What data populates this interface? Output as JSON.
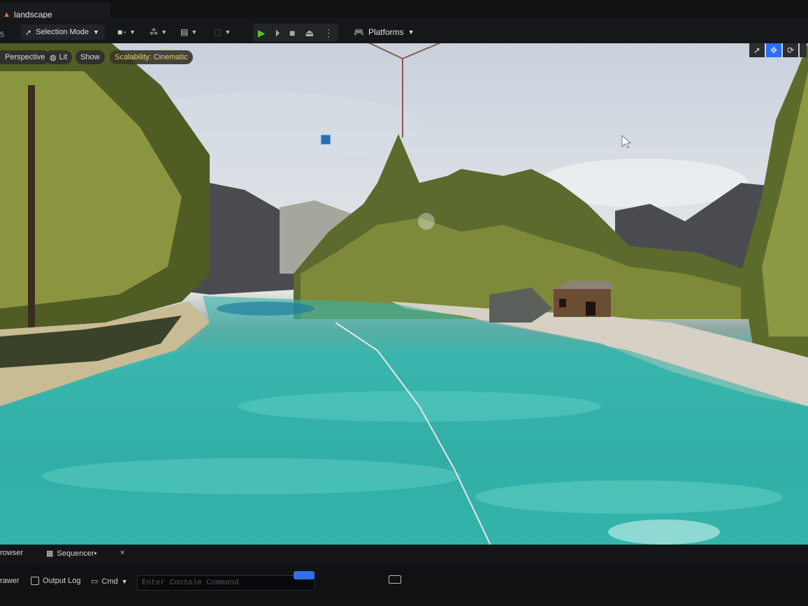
{
  "window": {
    "tab_title": "landscape",
    "left_index": "5"
  },
  "toolbar": {
    "selection_mode": "Selection Mode",
    "platforms": "Platforms",
    "play_icons": [
      "play-icon",
      "step-icon",
      "stop-icon",
      "eject-icon",
      "more-icon"
    ]
  },
  "viewport": {
    "perspective": "Perspective",
    "lit": "Lit",
    "show": "Show",
    "scalability": "Scalability: Cinematic"
  },
  "bottom": {
    "browser_tab": "rowser",
    "sequencer_tab": "Sequencer•",
    "drawer": "rawer",
    "output_log": "Output Log",
    "cmd": "Cmd",
    "console_placeholder": "Enter Console Command"
  },
  "colors": {
    "accent_blue": "#2d6ff0",
    "play_green": "#55c12b",
    "scalability_text": "#e9cd6a"
  }
}
